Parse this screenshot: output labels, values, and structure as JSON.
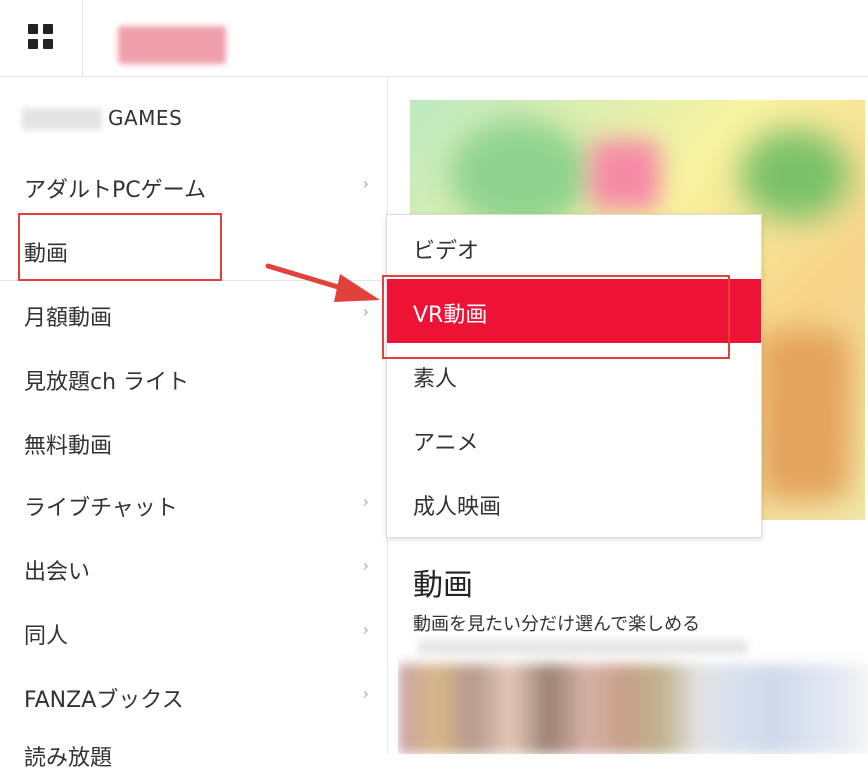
{
  "header": {
    "menu_icon": "grid-icon",
    "logo_text": ""
  },
  "sidebar": {
    "games_label": "GAMES",
    "items": [
      {
        "label": "アダルトPCゲーム",
        "chevron": "›"
      },
      {
        "label": "動画",
        "chevron": ""
      },
      {
        "label": "月額動画",
        "chevron": "›"
      },
      {
        "label": "見放題ch ライト",
        "chevron": ""
      },
      {
        "label": "無料動画",
        "chevron": ""
      },
      {
        "label": "ライブチャット",
        "chevron": "›"
      },
      {
        "label": "出会い",
        "chevron": "›"
      },
      {
        "label": "同人",
        "chevron": "›"
      },
      {
        "label": "FANZAブックス",
        "chevron": "›"
      },
      {
        "label": "読み放題",
        "chevron": ""
      }
    ]
  },
  "dropdown": {
    "items": [
      {
        "label": "ビデオ"
      },
      {
        "label": "VR動画"
      },
      {
        "label": "素人"
      },
      {
        "label": "アニメ"
      },
      {
        "label": "成人映画"
      }
    ]
  },
  "main": {
    "section_title": "動画",
    "section_subtitle": "動画を見たい分だけ選んで楽しめる"
  },
  "annotation": {
    "arrow_color": "#e0413a",
    "highlight_color": "#e0413a"
  },
  "colors": {
    "active_bg": "#ee1234"
  }
}
